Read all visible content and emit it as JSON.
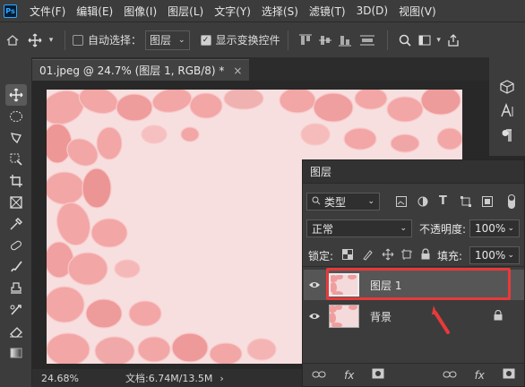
{
  "menubar": {
    "logo": "Ps",
    "items": [
      "文件(F)",
      "编辑(E)",
      "图像(I)",
      "图层(L)",
      "文字(Y)",
      "选择(S)",
      "滤镜(T)",
      "3D(D)",
      "视图(V)"
    ]
  },
  "options": {
    "auto_select_label": "自动选择：",
    "auto_select_target": "图层",
    "show_transform_label": "显示变换控件",
    "auto_select_checked": false,
    "show_transform_checked": true
  },
  "document": {
    "tab_title": "01.jpeg @ 24.7% (图层 1, RGB/8) *",
    "close_glyph": "×"
  },
  "status": {
    "zoom": "24.68%",
    "doc_info": "文档:6.74M/13.5M",
    "arrow": "›"
  },
  "layers_panel": {
    "title": "图层",
    "filter_kind": "类型",
    "blend_mode": "正常",
    "opacity_label": "不透明度:",
    "opacity_value": "100%",
    "lock_label": "锁定:",
    "fill_label": "填充:",
    "fill_value": "100%",
    "layers": [
      {
        "name": "图层 1",
        "visible": true,
        "selected": true,
        "locked": false
      },
      {
        "name": "背景",
        "visible": true,
        "selected": false,
        "locked": true
      }
    ]
  },
  "colors": {
    "highlight": "#e8393a",
    "accent": "#31a8ff",
    "photo_bg": "#f7dfe0",
    "petal": "#f2a6a6"
  }
}
